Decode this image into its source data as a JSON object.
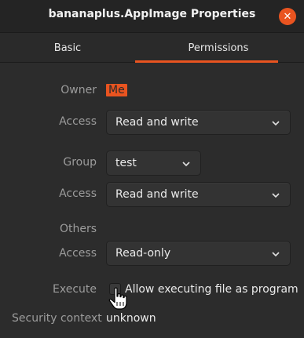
{
  "window": {
    "title": "bananaplus.AppImage Properties"
  },
  "icons": {
    "close": "close-icon",
    "chevron": "chevron-down-icon",
    "cursor": "hand-pointer-icon"
  },
  "tabs": [
    {
      "label": "Basic"
    },
    {
      "label": "Permissions"
    }
  ],
  "permissions": {
    "owner_label": "Owner",
    "owner_value": "Me",
    "owner_access_label": "Access",
    "owner_access_value": "Read and write",
    "group_label": "Group",
    "group_value": "test",
    "group_access_label": "Access",
    "group_access_value": "Read and write",
    "others_label": "Others",
    "others_access_label": "Access",
    "others_access_value": "Read-only",
    "execute_label": "Execute",
    "execute_checkbox_label": "Allow executing file as program",
    "execute_checked": false,
    "security_context_label": "Security context",
    "security_context_value": "unknown"
  },
  "colors": {
    "accent": "#e95420",
    "background": "#2c2c2c"
  }
}
